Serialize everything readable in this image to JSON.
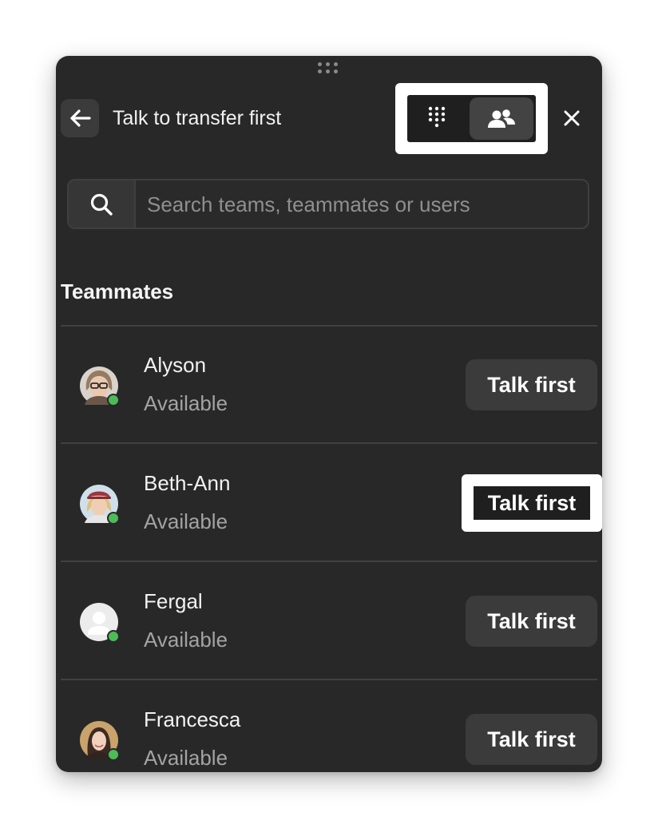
{
  "header": {
    "title": "Talk to transfer first"
  },
  "icons": {
    "back": "arrow-left-icon",
    "dialpad": "dialpad-icon",
    "people": "people-icon",
    "close": "close-icon",
    "search": "search-icon",
    "drag": "drag-handle-icon"
  },
  "search": {
    "placeholder": "Search teams, teammates or users",
    "value": ""
  },
  "section": {
    "heading": "Teammates"
  },
  "teammates": [
    {
      "name": "Alyson",
      "status": "Available",
      "action": "Talk first"
    },
    {
      "name": "Beth-Ann",
      "status": "Available",
      "action": "Talk first"
    },
    {
      "name": "Fergal",
      "status": "Available",
      "action": "Talk first"
    },
    {
      "name": "Francesca",
      "status": "Available",
      "action": "Talk first"
    }
  ],
  "colors": {
    "panel": "#282828",
    "status_available": "#4dbb57",
    "button": "#3b3b3b",
    "highlight": "#ffffff"
  }
}
